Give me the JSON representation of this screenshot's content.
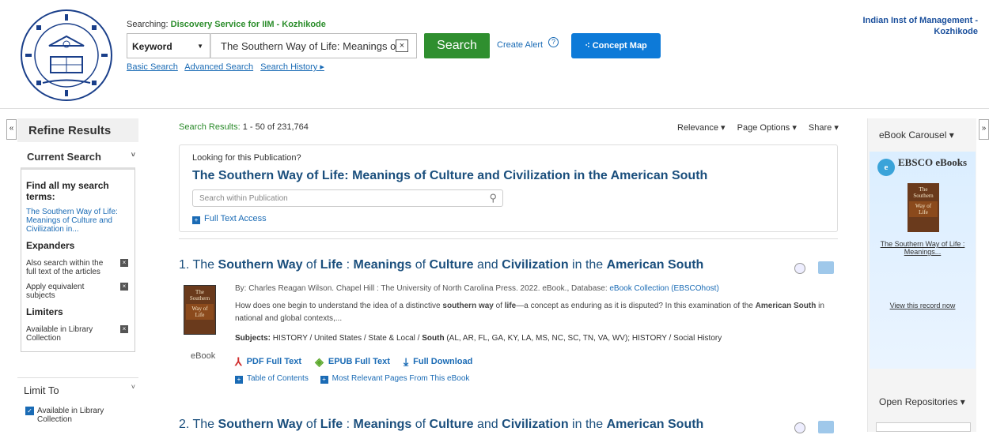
{
  "header": {
    "searching_label": "Searching:",
    "searching_db": "Discovery Service for IIM - Kozhikode",
    "field_select": "Keyword",
    "query": "The Southern Way of Life: Meanings of",
    "clear_symbol": "×",
    "search_button": "Search",
    "create_alert": "Create Alert",
    "help_symbol": "?",
    "concept_map": "Concept Map",
    "links": [
      "Basic Search",
      "Advanced Search",
      "Search History ▸"
    ],
    "institution": "Indian Inst of Management - Kozhikode"
  },
  "left": {
    "collapse_symbol": "«",
    "refine": "Refine Results",
    "current_search": "Current Search",
    "find_all": "Find all my search terms:",
    "terms": "The Southern Way of Life: Meanings of Culture and Civilization in...",
    "expanders": "Expanders",
    "expander_1": "Also search within the full text of the articles",
    "expander_2": "Apply equivalent subjects",
    "limiters": "Limiters",
    "limiter_1": "Available in Library Collection",
    "limit_to": "Limit To",
    "limit_opt": "Available in Library Collection",
    "remove_symbol": "×",
    "check_symbol": "✓"
  },
  "results": {
    "label": "Search Results:",
    "range": "1 - 50 of 231,764",
    "sort": [
      "Relevance ▾",
      "Page Options ▾",
      "Share ▾"
    ],
    "pub_prompt": "Looking for this Publication?",
    "pub_title": "The Southern Way of Life: Meanings of Culture and Civilization in the American South",
    "pub_search_placeholder": "Search within Publication",
    "full_text_access": "Full Text Access",
    "item1": {
      "num": "1.",
      "title_parts": [
        "The ",
        "Southern Way",
        " of ",
        "Life",
        " : ",
        "Meanings",
        " of ",
        "Culture",
        " and ",
        "Civilization",
        " in the ",
        "American South"
      ],
      "meta_prefix": "By: Charles Reagan Wilson. Chapel Hill : The University of North Carolina Press. 2022. eBook., Database: ",
      "meta_db": "eBook Collection (EBSCOhost)",
      "abstract_1": "How does one begin to understand the idea of a distinctive ",
      "abstract_b1": "southern way",
      "abstract_2": " of ",
      "abstract_b2": "life",
      "abstract_3": "—a concept as enduring as it is disputed? In this examination of the ",
      "abstract_b3": "American South",
      "abstract_4": " in national and global contexts,...",
      "subjects_label": "Subjects:",
      "subjects_1": " HISTORY / United States / State & Local / ",
      "subjects_b": "South",
      "subjects_2": " (AL, AR, FL, GA, KY, LA, MS, NC, SC, TN, VA, WV); HISTORY / Social History",
      "type": "eBook",
      "pdf": "PDF Full Text",
      "epub": "EPUB Full Text",
      "download": "Full Download",
      "toc": "Table of Contents",
      "relevant": "Most Relevant Pages From This eBook"
    },
    "item2": {
      "num": "2.",
      "title_parts": [
        "The ",
        "Southern Way",
        " of ",
        "Life",
        " : ",
        "Meanings",
        " of ",
        "Culture",
        " and ",
        "Civilization",
        " in the ",
        "American South"
      ]
    }
  },
  "cover": {
    "line1": "The",
    "line2": "Southern",
    "line3": "Way of",
    "line4": "Life"
  },
  "right": {
    "expand_symbol": "»",
    "carousel": "eBook Carousel ▾",
    "brand_mark": "e",
    "ebsco": "EBSCO eBooks",
    "book_title": "The Southern Way of Life : Meanings...",
    "view": "View this record now",
    "open_repos": "Open Repositories ▾"
  }
}
